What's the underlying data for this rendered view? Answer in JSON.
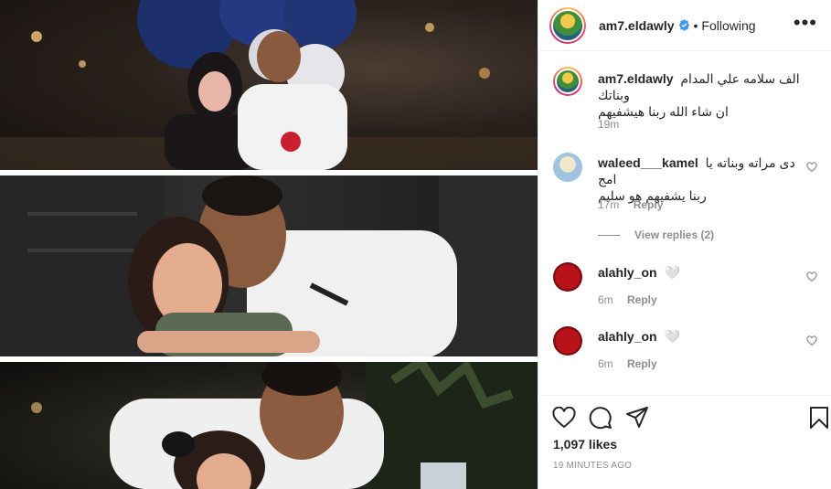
{
  "post": {
    "author": "am7.eldawly",
    "following_label": "Following",
    "more_label": "•••",
    "caption_line1": "الف سلامه علي المدام وبناتك",
    "caption_line2": "ان شاء الله ربنا هيشفيهم",
    "caption_time": "19m",
    "likes": "1,097 likes",
    "posted_ago": "19 MINUTES AGO"
  },
  "comments": [
    {
      "username": "waleed___kamel",
      "text_line1": "دى مراته وبناته يا امج",
      "text_line2": "ربنا يشفيهم هو سليم",
      "time": "17m",
      "reply_label": "Reply",
      "view_replies": "View replies (2)"
    },
    {
      "username": "alahly_on",
      "text": "🤍",
      "time": "6m",
      "reply_label": "Reply"
    },
    {
      "username": "alahly_on",
      "text": "🤍",
      "time": "6m",
      "reply_label": "Reply"
    }
  ],
  "icons": [
    "verified-badge-icon",
    "more-options-icon",
    "like-heart-icon",
    "comment-bubble-icon",
    "share-paper-plane-icon",
    "save-bookmark-icon",
    "comment-like-heart-icon"
  ],
  "colors": {
    "verified": "#3897f0",
    "secondary_text": "#8e8e8e",
    "divider": "#efefef",
    "ahly_red": "#b8131b"
  }
}
